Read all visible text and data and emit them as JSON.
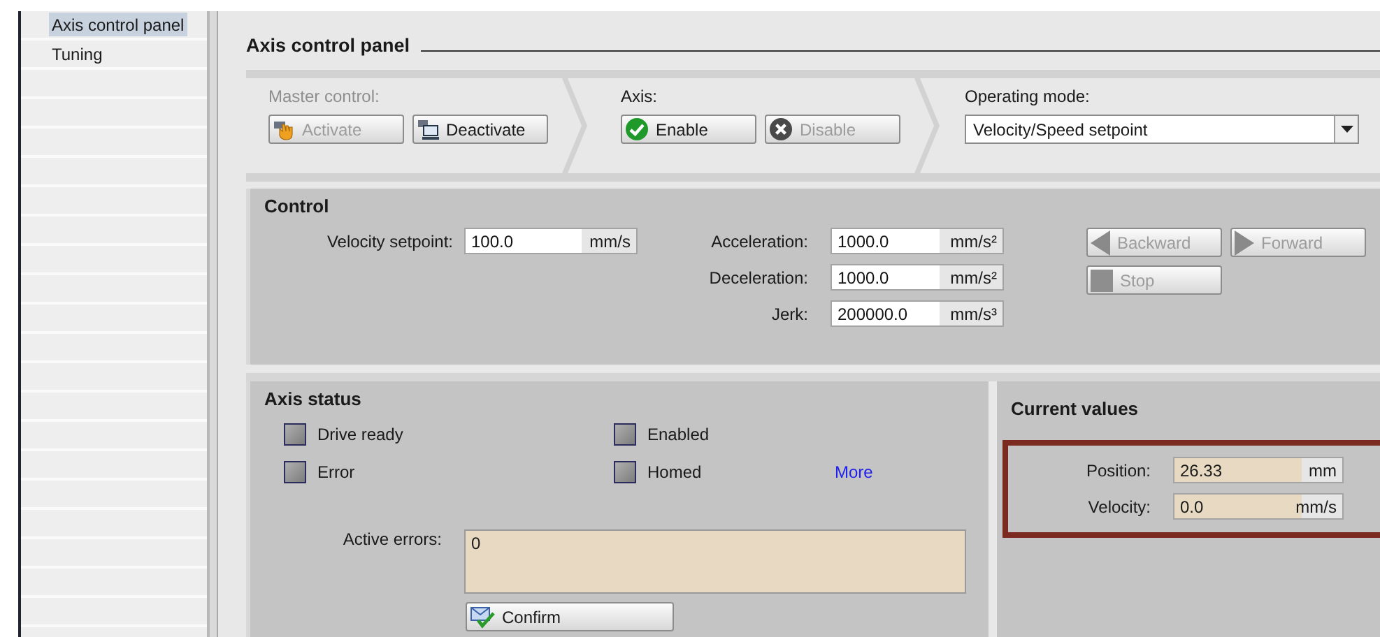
{
  "sidebar": {
    "items": [
      {
        "label": "Axis control panel",
        "selected": true
      },
      {
        "label": "Tuning",
        "selected": false
      }
    ]
  },
  "panel": {
    "title": "Axis control panel"
  },
  "toolbar": {
    "groups": [
      {
        "label": "Master control:",
        "disabled": true,
        "buttons": [
          {
            "label": "Activate",
            "disabled": true
          },
          {
            "label": "Deactivate",
            "disabled": false
          }
        ]
      },
      {
        "label": "Axis:",
        "disabled": false,
        "buttons": [
          {
            "label": "Enable",
            "disabled": false
          },
          {
            "label": "Disable",
            "disabled": true
          }
        ]
      }
    ],
    "operating_mode": {
      "label": "Operating mode:",
      "value": "Velocity/Speed setpoint"
    }
  },
  "control": {
    "title": "Control",
    "velocity": {
      "label": "Velocity setpoint:",
      "value": "100.0",
      "unit": "mm/s"
    },
    "params": [
      {
        "label": "Acceleration:",
        "value": "1000.0",
        "unit": "mm/s²"
      },
      {
        "label": "Deceleration:",
        "value": "1000.0",
        "unit": "mm/s²"
      },
      {
        "label": "Jerk:",
        "value": "200000.0",
        "unit": "mm/s³"
      }
    ],
    "jog_buttons": [
      {
        "label": "Backward",
        "disabled": true
      },
      {
        "label": "Forward",
        "disabled": true
      },
      {
        "label": "Stop",
        "disabled": true
      }
    ]
  },
  "axis_status": {
    "title": "Axis status",
    "indicators": [
      {
        "label": "Drive ready",
        "on": false
      },
      {
        "label": "Enabled",
        "on": false
      },
      {
        "label": "Error",
        "on": false
      },
      {
        "label": "Homed",
        "on": false
      }
    ],
    "more_link": "More",
    "active_errors": {
      "label": "Active errors:",
      "value": "0"
    },
    "confirm_button": {
      "label": "Confirm"
    }
  },
  "current_values": {
    "title": "Current values",
    "highlighted": true,
    "rows": [
      {
        "label": "Position:",
        "value": "26.33",
        "unit": "mm"
      },
      {
        "label": "Velocity:",
        "value": "0.0",
        "unit": "mm/s"
      }
    ]
  }
}
